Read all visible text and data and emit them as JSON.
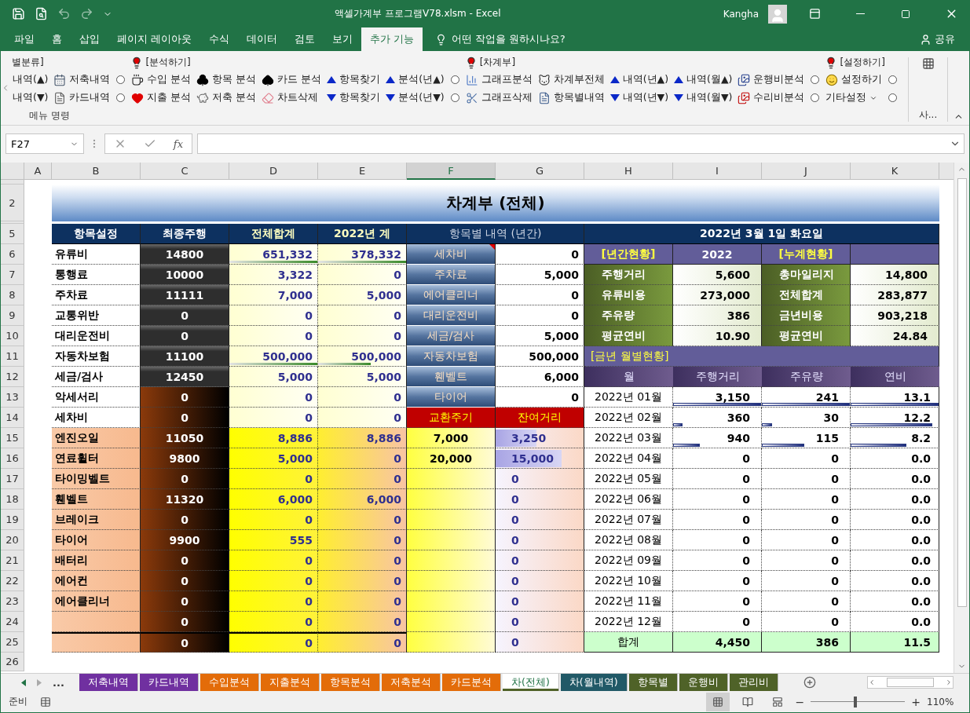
{
  "window": {
    "title": "액셀가계부 프로그램V78.xlsm  -  Excel",
    "user": "Kangha"
  },
  "menu_tabs": [
    {
      "label": "파일",
      "selected": false
    },
    {
      "label": "홈",
      "selected": false
    },
    {
      "label": "삽입",
      "selected": false
    },
    {
      "label": "페이지 레이아웃",
      "selected": false
    },
    {
      "label": "수식",
      "selected": false
    },
    {
      "label": "데이터",
      "selected": false
    },
    {
      "label": "검토",
      "selected": false
    },
    {
      "label": "보기",
      "selected": false
    },
    {
      "label": "추가 기능",
      "selected": true
    }
  ],
  "tell_me": {
    "text": "어떤 작업을 원하시나요?"
  },
  "share": "공유",
  "ribbon": {
    "columns": [
      {
        "kind": "buttons",
        "header": {
          "text": "별분류]",
          "bulb": false
        },
        "items": [
          {
            "label": "내역(▲)"
          },
          {
            "label": "내역(▼)"
          }
        ]
      },
      {
        "kind": "buttons",
        "items": [
          {
            "label": "저축내역"
          },
          {
            "label": "카드내역"
          }
        ]
      },
      {
        "kind": "radio",
        "items": [
          {
            "selected": false
          },
          {
            "selected": false
          }
        ]
      },
      {
        "kind": "buttons",
        "header": {
          "text": "[분석하기]",
          "bulb": true
        },
        "items": [
          {
            "label": "수입 분석"
          },
          {
            "label": "지출 분석"
          }
        ]
      },
      {
        "kind": "buttons",
        "items": [
          {
            "label": "항목 분석"
          },
          {
            "label": "저축 분석"
          }
        ]
      },
      {
        "kind": "buttons",
        "items": [
          {
            "label": "카드 분석"
          },
          {
            "label": "차트삭제"
          }
        ]
      },
      {
        "kind": "buttons",
        "items": [
          {
            "label": "항목찾기"
          },
          {
            "label": "항목찾기"
          }
        ]
      },
      {
        "kind": "buttons",
        "items": [
          {
            "label": "분석(년▲)"
          },
          {
            "label": "분석(년▼)"
          }
        ]
      },
      {
        "kind": "radio",
        "items": [
          {
            "selected": false
          },
          {
            "selected": false
          }
        ]
      },
      {
        "kind": "buttons",
        "header": {
          "text": "[차계부]",
          "bulb": true
        },
        "items": [
          {
            "label": "그래프분석"
          },
          {
            "label": "그래프삭제"
          }
        ]
      },
      {
        "kind": "buttons",
        "items": [
          {
            "label": "차계부전체"
          },
          {
            "label": "항목별내역"
          }
        ]
      },
      {
        "kind": "buttons",
        "items": [
          {
            "label": "내역(년▲)"
          },
          {
            "label": "내역(년▼)"
          }
        ]
      },
      {
        "kind": "buttons",
        "items": [
          {
            "label": "내역(월▲)"
          },
          {
            "label": "내역(월▼)"
          }
        ]
      },
      {
        "kind": "buttons",
        "items": [
          {
            "label": "운행비분석"
          },
          {
            "label": "수리비분석"
          }
        ]
      },
      {
        "kind": "radio",
        "items": [
          {
            "selected": false
          },
          {
            "selected": false
          }
        ]
      },
      {
        "kind": "buttons",
        "header": {
          "text": "[설정하기]",
          "bulb": true
        },
        "items": [
          {
            "label": "설정하기"
          },
          {
            "label": "기타설정",
            "dropdown": true
          }
        ]
      },
      {
        "kind": "radio",
        "items": [
          {
            "selected": false
          },
          {
            "selected": false
          }
        ]
      }
    ],
    "group_label": "메뉴 명령",
    "side_group_label": "사..."
  },
  "formula_bar": {
    "name_box": "F27",
    "fx": "fx"
  },
  "column_headers": [
    {
      "label": "A",
      "selected": false
    },
    {
      "label": "B",
      "selected": false
    },
    {
      "label": "C",
      "selected": false
    },
    {
      "label": "D",
      "selected": false
    },
    {
      "label": "E",
      "selected": false
    },
    {
      "label": "F",
      "selected": true
    },
    {
      "label": "G",
      "selected": false
    },
    {
      "label": "H",
      "selected": false
    },
    {
      "label": "I",
      "selected": false
    },
    {
      "label": "J",
      "selected": false
    },
    {
      "label": "K",
      "selected": false
    }
  ],
  "sheet": {
    "title_row": "2",
    "title": "차계부 (전체)",
    "header_row": {
      "row": "5",
      "cells": [
        "항목설정",
        "최종주행",
        "전체합계",
        "2022년 계",
        "항목별 내역 (년간)",
        "2022년 3월 1일 화요일"
      ]
    },
    "rows": [
      {
        "row": "6",
        "left": {
          "kind": "fixed",
          "name": "유류비",
          "mileage": "14800",
          "total": "651,332",
          "year_total": "378,332",
          "total_bar": {
            "level": 1
          },
          "year_bar": {
            "level": 1
          }
        },
        "mid": {
          "kind": "item",
          "label": "세차비",
          "value": "0",
          "comment": true
        },
        "right": {
          "kind": "section",
          "label": "[년간현황]",
          "value": "2022",
          "label2": "[누계현황]"
        }
      },
      {
        "row": "7",
        "left": {
          "kind": "fixed",
          "name": "통행료",
          "mileage": "10000",
          "total": "3,322",
          "year_total": "0"
        },
        "mid": {
          "kind": "item",
          "label": "주차료",
          "value": "5,000",
          "comment": false
        },
        "right": {
          "kind": "stat",
          "label": "주행거리",
          "value": "5,600",
          "label2": "총마일리지",
          "value2": "14,800"
        }
      },
      {
        "row": "8",
        "left": {
          "kind": "fixed",
          "name": "주차료",
          "mileage": "11111",
          "total": "7,000",
          "year_total": "5,000"
        },
        "mid": {
          "kind": "item",
          "label": "에어클리너",
          "value": "0",
          "comment": false
        },
        "right": {
          "kind": "stat",
          "label": "유류비용",
          "value": "273,000",
          "label2": "전체합계",
          "value2": "283,877"
        }
      },
      {
        "row": "9",
        "left": {
          "kind": "fixed",
          "name": "교통위반",
          "mileage": "0",
          "total": "0",
          "year_total": "0"
        },
        "mid": {
          "kind": "item",
          "label": "대리운전비",
          "value": "0",
          "comment": false
        },
        "right": {
          "kind": "stat",
          "label": "주유량",
          "value": "386",
          "label2": "금년비용",
          "value2": "903,218"
        }
      },
      {
        "row": "10",
        "left": {
          "kind": "fixed",
          "name": "대리운전비",
          "mileage": "0",
          "total": "0",
          "year_total": "0"
        },
        "mid": {
          "kind": "item",
          "label": "세금/검사",
          "value": "5,000",
          "comment": false
        },
        "right": {
          "kind": "stat",
          "label": "평균연비",
          "value": "10.90",
          "label2": "평균연비",
          "value2": "24.84"
        }
      },
      {
        "row": "11",
        "left": {
          "kind": "fixed",
          "name": "자동차보험",
          "mileage": "11100",
          "total": "500,000",
          "year_total": "500,000",
          "total_bar": {
            "level": 1
          },
          "year_bar": {
            "level": 0.6
          }
        },
        "mid": {
          "kind": "item",
          "label": "자동차보험",
          "value": "500,000",
          "comment": false
        },
        "right": {
          "kind": "banner",
          "label": "[금년 월별현황]"
        }
      },
      {
        "row": "12",
        "left": {
          "kind": "fixed",
          "name": "세금/검사",
          "mileage": "12450",
          "total": "5,000",
          "year_total": "5,000"
        },
        "mid": {
          "kind": "item",
          "label": "휀벨트",
          "value": "6,000",
          "comment": false
        },
        "right": {
          "kind": "columns",
          "cells": [
            "월",
            "주행거리",
            "주유량",
            "연비"
          ]
        }
      },
      {
        "row": "13",
        "left": {
          "kind": "extra",
          "name": "악세서리",
          "mileage": "0",
          "total": "0",
          "year_total": "0"
        },
        "mid": {
          "kind": "item",
          "label": "타이어",
          "value": "0",
          "comment": false
        },
        "right": {
          "kind": "month",
          "month": "2022년 01월",
          "distance": "3,150",
          "fuel": "241",
          "efficiency": "13.1",
          "distance_bar": {
            "level": 1
          },
          "fuel_bar": {
            "level": 1
          },
          "efficiency_bar": {
            "level": 1
          }
        }
      },
      {
        "row": "14",
        "left": {
          "kind": "extra",
          "name": "세차비",
          "mileage": "0",
          "total": "0",
          "year_total": "0"
        },
        "mid": {
          "kind": "header",
          "label": "교환주기",
          "value": "잔여거리"
        },
        "right": {
          "kind": "month",
          "month": "2022년 02월",
          "distance": "360",
          "fuel": "30",
          "efficiency": "12.2",
          "distance_bar": {
            "level": 0.11
          },
          "fuel_bar": {
            "level": 0.12
          },
          "efficiency_bar": {
            "level": 0.93
          }
        }
      },
      {
        "row": "15",
        "left": {
          "kind": "part",
          "name": "엔진오일",
          "mileage": "11050",
          "total": "8,886",
          "year_total": "8,886"
        },
        "mid": {
          "kind": "cycle",
          "cycle": "7,000",
          "remaining": "3,250",
          "bar": {
            "level": 0.46
          }
        },
        "right": {
          "kind": "month",
          "month": "2022년 03월",
          "distance": "940",
          "fuel": "115",
          "efficiency": "8.2",
          "distance_bar": {
            "level": 0.3
          },
          "fuel_bar": {
            "level": 0.48
          },
          "efficiency_bar": {
            "level": 0.63
          }
        }
      },
      {
        "row": "16",
        "left": {
          "kind": "part",
          "name": "연료휠터",
          "mileage": "9800",
          "total": "5,000",
          "year_total": "0"
        },
        "mid": {
          "kind": "cycle",
          "cycle": "20,000",
          "remaining": "15,000",
          "bar": {
            "level": 0.75
          }
        },
        "right": {
          "kind": "month",
          "month": "2022년 04월",
          "distance": "0",
          "fuel": "0",
          "efficiency": "0.0"
        }
      },
      {
        "row": "17",
        "left": {
          "kind": "part",
          "name": "타이밍벨트",
          "mileage": "0",
          "total": "0",
          "year_total": "0"
        },
        "mid": {
          "kind": "cycle",
          "remaining": "0"
        },
        "right": {
          "kind": "month",
          "month": "2022년 05월",
          "distance": "0",
          "fuel": "0",
          "efficiency": "0.0"
        }
      },
      {
        "row": "18",
        "left": {
          "kind": "part",
          "name": "휀벨트",
          "mileage": "11320",
          "total": "6,000",
          "year_total": "6,000"
        },
        "mid": {
          "kind": "cycle",
          "remaining": "0"
        },
        "right": {
          "kind": "month",
          "month": "2022년 06월",
          "distance": "0",
          "fuel": "0",
          "efficiency": "0.0"
        }
      },
      {
        "row": "19",
        "left": {
          "kind": "part",
          "name": "브레이크",
          "mileage": "0",
          "total": "0",
          "year_total": "0"
        },
        "mid": {
          "kind": "cycle",
          "remaining": "0"
        },
        "right": {
          "kind": "month",
          "month": "2022년 07월",
          "distance": "0",
          "fuel": "0",
          "efficiency": "0.0"
        }
      },
      {
        "row": "20",
        "left": {
          "kind": "part",
          "name": "타이어",
          "mileage": "9900",
          "total": "555",
          "year_total": "0"
        },
        "mid": {
          "kind": "cycle",
          "remaining": "0"
        },
        "right": {
          "kind": "month",
          "month": "2022년 08월",
          "distance": "0",
          "fuel": "0",
          "efficiency": "0.0"
        }
      },
      {
        "row": "21",
        "left": {
          "kind": "part",
          "name": "배터리",
          "mileage": "0",
          "total": "0",
          "year_total": "0"
        },
        "mid": {
          "kind": "cycle",
          "remaining": "0"
        },
        "right": {
          "kind": "month",
          "month": "2022년 09월",
          "distance": "0",
          "fuel": "0",
          "efficiency": "0.0"
        }
      },
      {
        "row": "22",
        "left": {
          "kind": "part",
          "name": "에어컨",
          "mileage": "0",
          "total": "0",
          "year_total": "0"
        },
        "mid": {
          "kind": "cycle",
          "remaining": "0"
        },
        "right": {
          "kind": "month",
          "month": "2022년 10월",
          "distance": "0",
          "fuel": "0",
          "efficiency": "0.0"
        }
      },
      {
        "row": "23",
        "left": {
          "kind": "part",
          "name": "에어클리너",
          "mileage": "0",
          "total": "0",
          "year_total": "0"
        },
        "mid": {
          "kind": "cycle",
          "remaining": "0"
        },
        "right": {
          "kind": "month",
          "month": "2022년 11월",
          "distance": "0",
          "fuel": "0",
          "efficiency": "0.0"
        }
      },
      {
        "row": "24",
        "left": {
          "kind": "part",
          "mileage": "0",
          "total": "0",
          "year_total": "0"
        },
        "mid": {
          "kind": "cycle",
          "remaining": "0"
        },
        "right": {
          "kind": "month",
          "month": "2022년 12월",
          "distance": "0",
          "fuel": "0",
          "efficiency": "0.0"
        }
      },
      {
        "row": "25",
        "left": {
          "kind": "total",
          "mileage": "0",
          "total": "0",
          "year_total": "0"
        },
        "mid": {
          "kind": "cycle",
          "remaining": "0"
        },
        "right": {
          "kind": "total",
          "label": "합계",
          "distance": "4,450",
          "fuel": "386",
          "efficiency": "11.5"
        }
      }
    ],
    "last_row": "26"
  },
  "sheet_tabs": {
    "more": "...",
    "tabs": [
      {
        "label": "저축내역",
        "color": "#7030a0",
        "selected": false
      },
      {
        "label": "카드내역",
        "color": "#7030a0",
        "selected": false
      },
      {
        "label": "수입분석",
        "color": "#e36c09",
        "selected": false
      },
      {
        "label": "지출분석",
        "color": "#e36c09",
        "selected": false
      },
      {
        "label": "항목분석",
        "color": "#e36c09",
        "selected": false
      },
      {
        "label": "저축분석",
        "color": "#e36c09",
        "selected": false
      },
      {
        "label": "카드분석",
        "color": "#e36c09",
        "selected": false
      },
      {
        "label": "차(전체)",
        "color": "#4f6228",
        "selected": true
      },
      {
        "label": "차(월내역)",
        "color": "#215967",
        "selected": false
      },
      {
        "label": "항목별",
        "color": "#4f6228",
        "selected": false
      },
      {
        "label": "운행비",
        "color": "#4f6228",
        "selected": false
      },
      {
        "label": "관리비",
        "color": "#4f6228",
        "selected": false
      }
    ]
  },
  "status_bar": {
    "ready": "준비",
    "views": [
      {
        "selected": true
      },
      {
        "selected": false
      },
      {
        "selected": false
      }
    ],
    "zoom": {
      "out": "−",
      "in": "+",
      "level": 0.46,
      "reading": "110%"
    }
  }
}
